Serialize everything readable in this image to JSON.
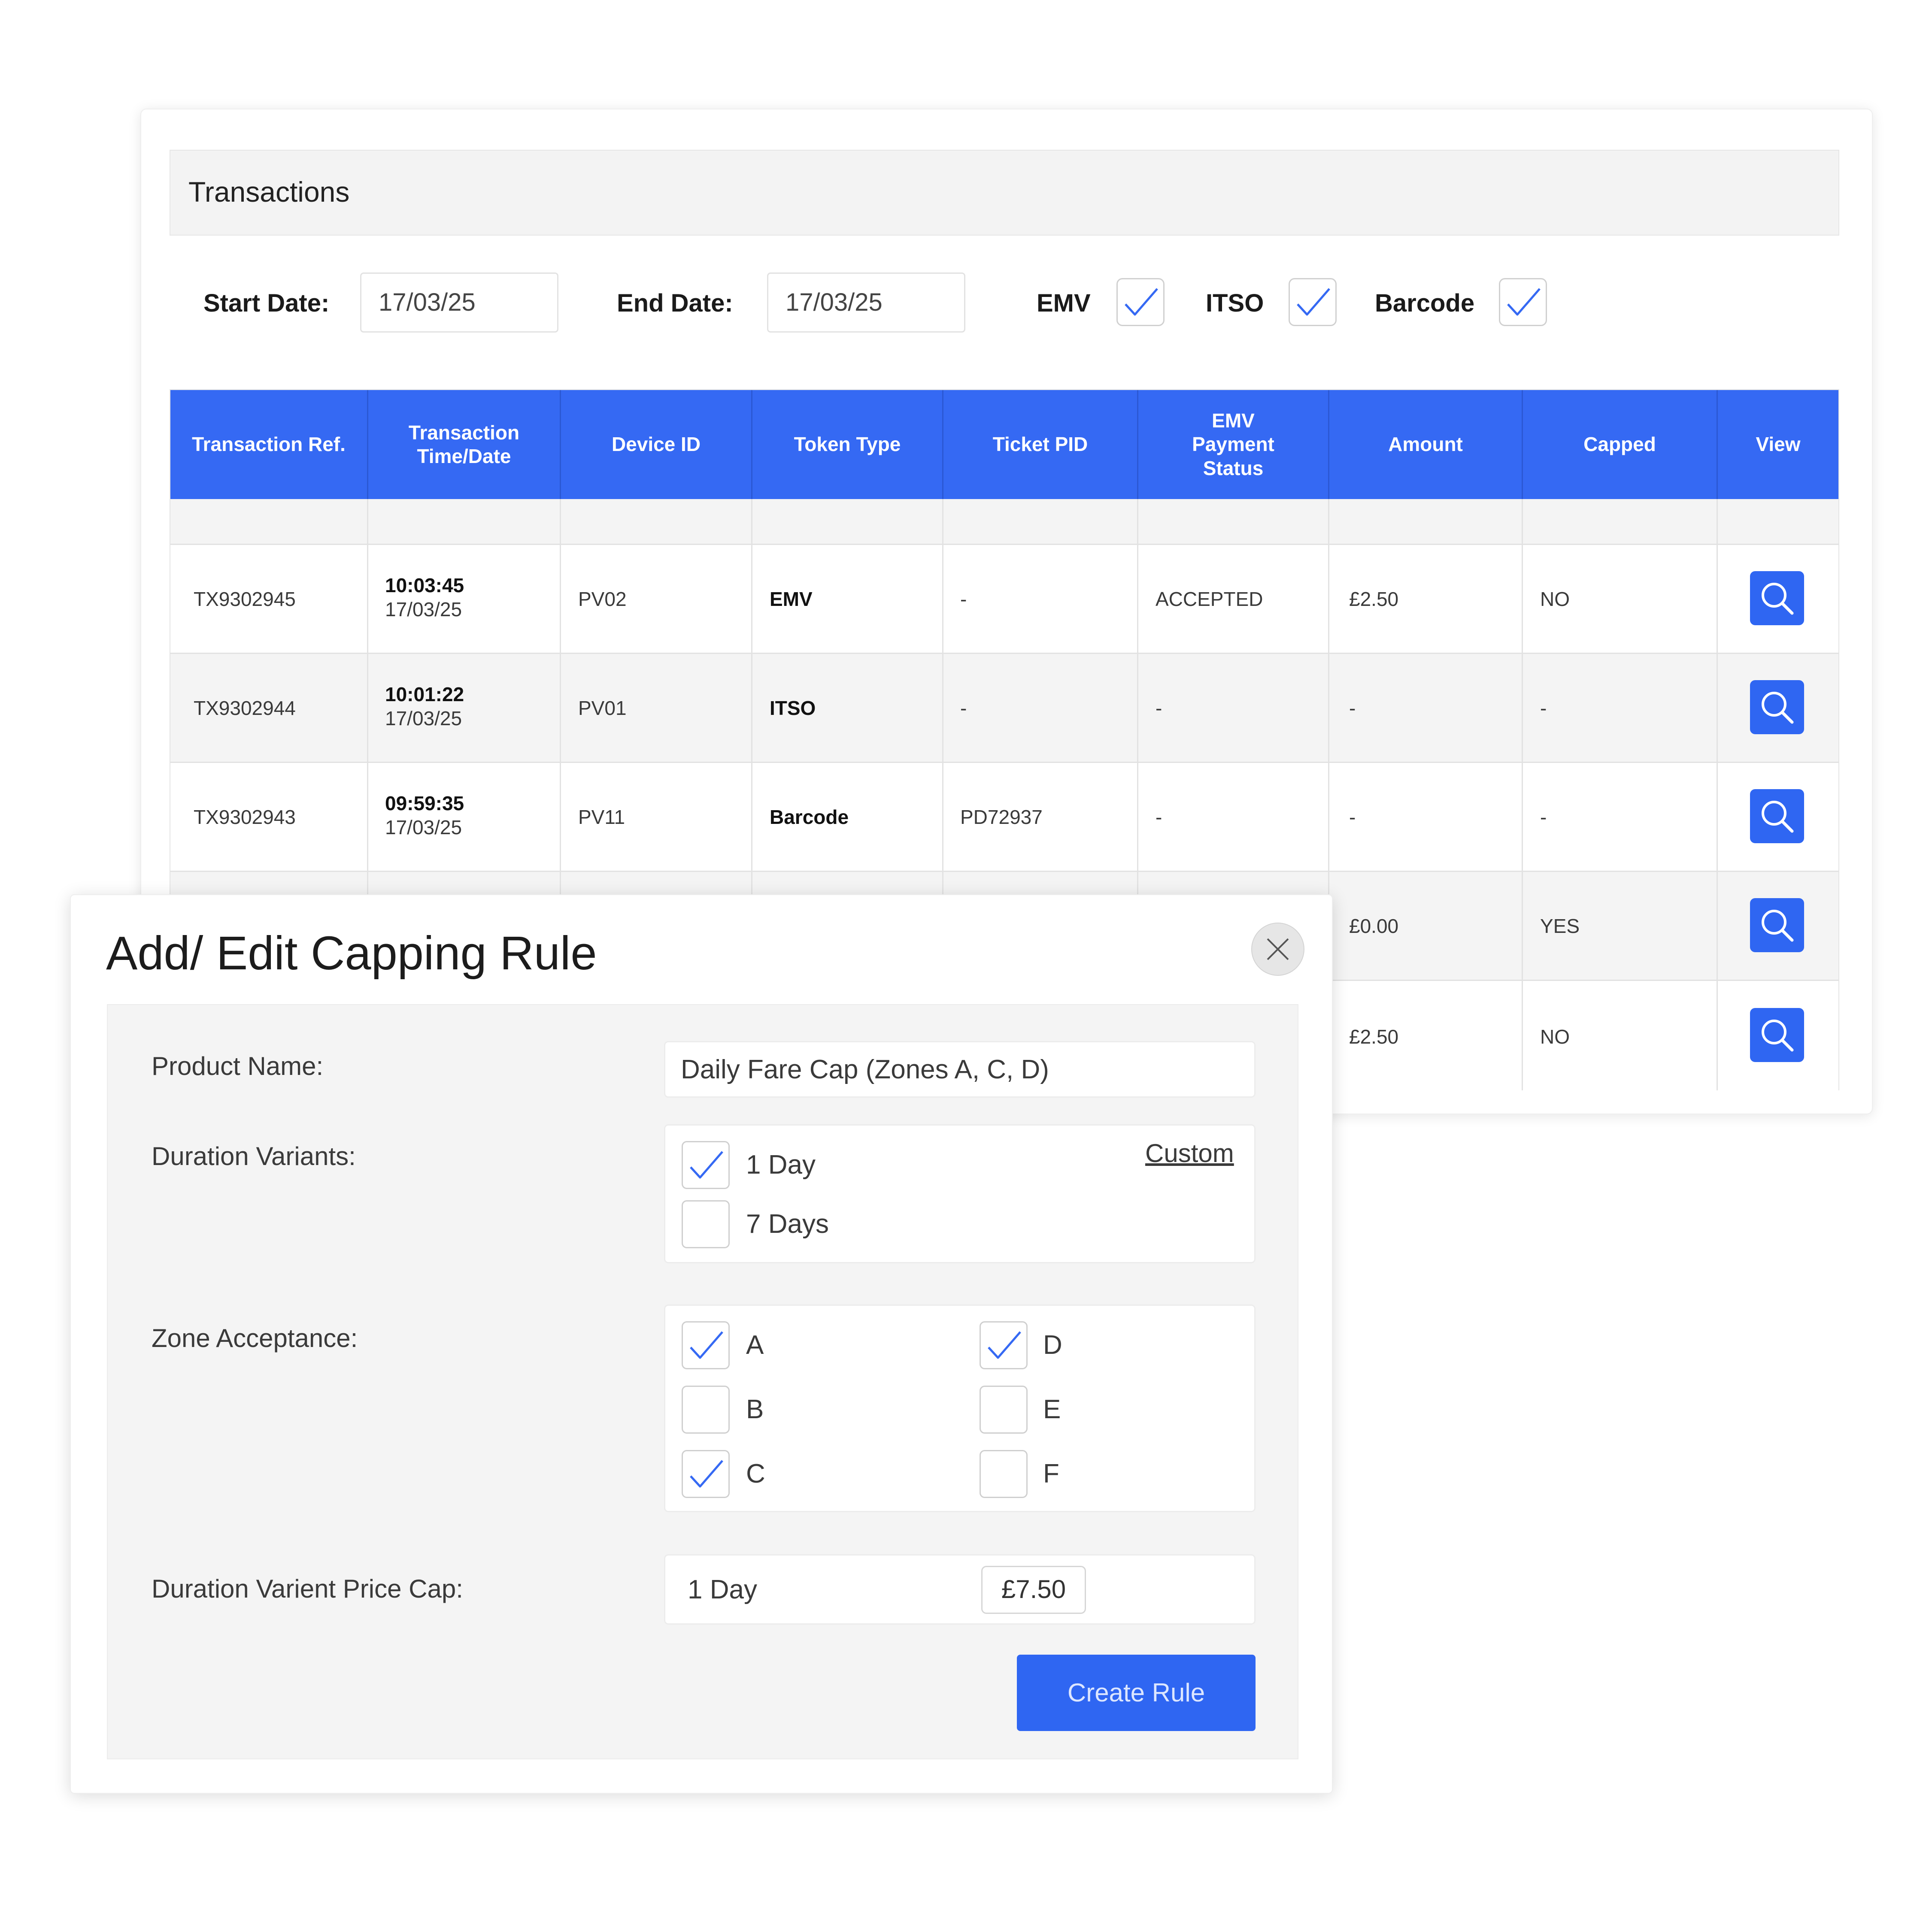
{
  "transactions": {
    "title": "Transactions",
    "filters": {
      "start_label": "Start Date:",
      "start_value": "17/03/25",
      "end_label": "End Date:",
      "end_value": "17/03/25",
      "token_filters": [
        {
          "label": "EMV",
          "checked": true
        },
        {
          "label": "ITSO",
          "checked": true
        },
        {
          "label": "Barcode",
          "checked": true
        }
      ]
    },
    "columns": [
      "Transaction Ref.",
      "Transaction Time/Date",
      "Device ID",
      "Token Type",
      "Ticket PID",
      "EMV Payment Status",
      "Amount",
      "Capped",
      "View"
    ],
    "rows": [
      {
        "ref": "TX9302945",
        "time": "10:03:45",
        "date": "17/03/25",
        "device": "PV02",
        "token": "EMV",
        "pid": "-",
        "status": "ACCEPTED",
        "amount": "£2.50",
        "capped": "NO"
      },
      {
        "ref": "TX9302944",
        "time": "10:01:22",
        "date": "17/03/25",
        "device": "PV01",
        "token": "ITSO",
        "pid": "-",
        "status": "-",
        "amount": "-",
        "capped": "-"
      },
      {
        "ref": "TX9302943",
        "time": "09:59:35",
        "date": "17/03/25",
        "device": "PV11",
        "token": "Barcode",
        "pid": "PD72937",
        "status": "-",
        "amount": "-",
        "capped": "-"
      },
      {
        "amount": "£0.00",
        "capped": "YES"
      },
      {
        "amount": "£2.50",
        "capped": "NO"
      }
    ],
    "icons": {
      "view": "search-icon",
      "check": "checkmark-icon"
    },
    "accent_color": "#3569f3"
  },
  "modal": {
    "title": "Add/ Edit Capping Rule",
    "close_icon": "close-icon",
    "product_name_label": "Product Name:",
    "product_name_value": "Daily Fare Cap (Zones A, C, D)",
    "duration_label": "Duration Variants:",
    "custom_link": "Custom",
    "durations": [
      {
        "label": "1 Day",
        "checked": true
      },
      {
        "label": "7 Days",
        "checked": false
      }
    ],
    "zone_label": "Zone Acceptance:",
    "zones": [
      {
        "label": "A",
        "checked": true
      },
      {
        "label": "B",
        "checked": false
      },
      {
        "label": "C",
        "checked": true
      },
      {
        "label": "D",
        "checked": true
      },
      {
        "label": "E",
        "checked": false
      },
      {
        "label": "F",
        "checked": false
      }
    ],
    "price_cap_label": "Duration Varient Price Cap:",
    "price_cap_variant": "1 Day",
    "price_cap_value": "£7.50",
    "create_button": "Create Rule",
    "button_color": "#2f66f2"
  }
}
